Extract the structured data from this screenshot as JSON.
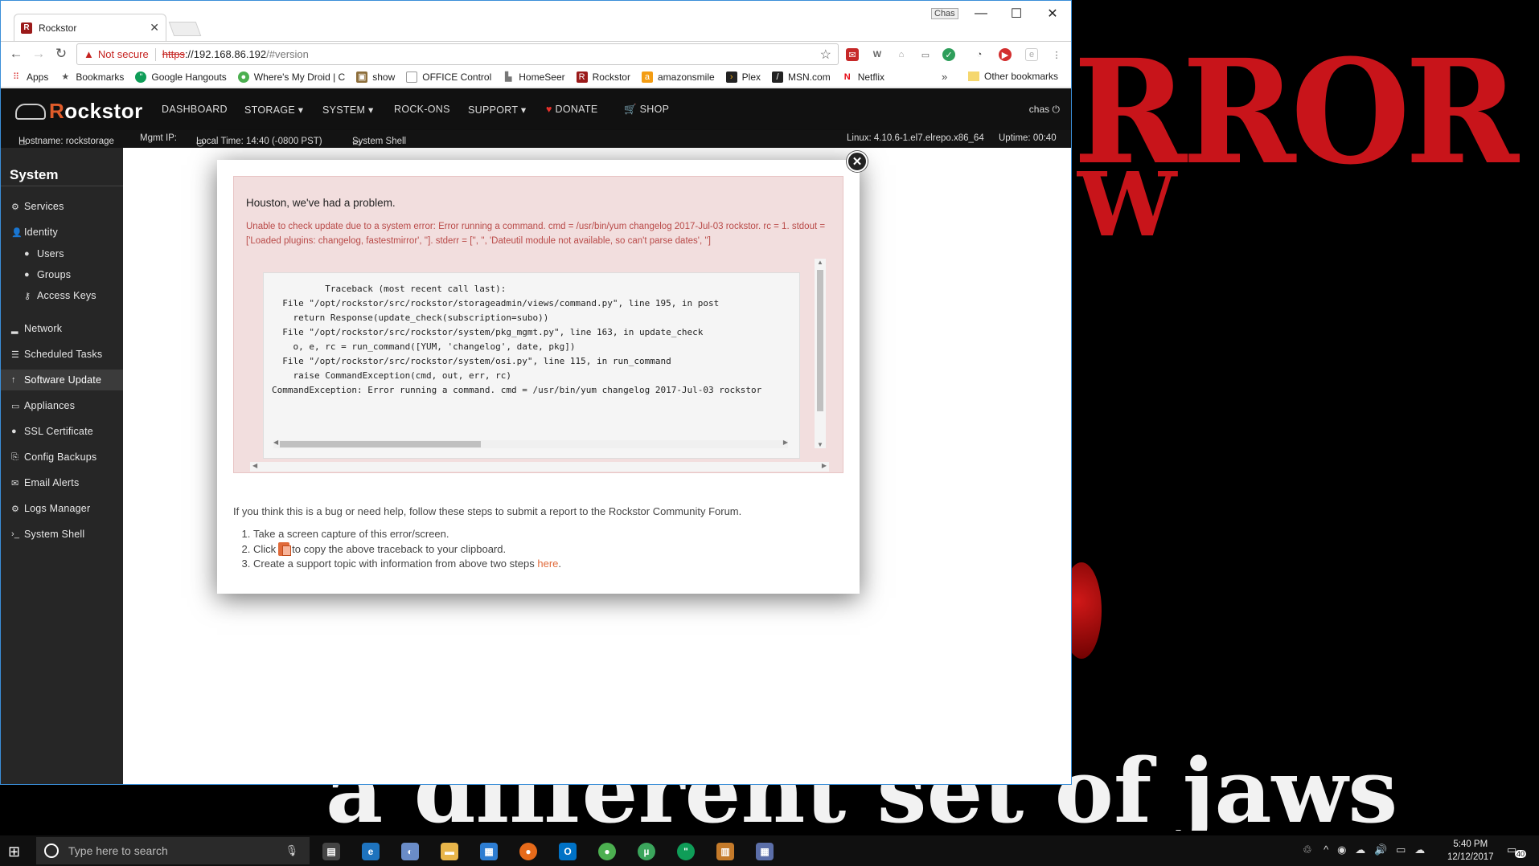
{
  "browser": {
    "tab_title": "Rockstor",
    "tab_favicon": "R",
    "window_user": "Chas",
    "address": {
      "security_label": "Not secure",
      "scheme": "https",
      "host": "://192.168.86.192",
      "path": "/#version"
    },
    "bookmarks": [
      {
        "label": "Apps",
        "icon": "apps-grid-icon"
      },
      {
        "label": "Bookmarks",
        "icon": "star-icon"
      },
      {
        "label": "Google Hangouts",
        "icon": "hangouts-icon"
      },
      {
        "label": "Where's My Droid | C",
        "icon": "droid-icon"
      },
      {
        "label": "show",
        "icon": "show-icon"
      },
      {
        "label": "OFFICE Control",
        "icon": "page-icon"
      },
      {
        "label": "HomeSeer",
        "icon": "homeseer-icon"
      },
      {
        "label": "Rockstor",
        "icon": "rockstor-icon"
      },
      {
        "label": "amazonsmile",
        "icon": "amazon-icon"
      },
      {
        "label": "Plex",
        "icon": "plex-icon"
      },
      {
        "label": "MSN.com",
        "icon": "msn-icon"
      },
      {
        "label": "Netflix",
        "icon": "netflix-icon"
      }
    ],
    "bookmarks_more": "»",
    "other_bookmarks": "Other bookmarks"
  },
  "app": {
    "brand_prefix": "R",
    "brand_rest": "ockstor",
    "nav": [
      {
        "label": "DASHBOARD"
      },
      {
        "label": "STORAGE ▾"
      },
      {
        "label": "SYSTEM ▾"
      },
      {
        "label": "ROCK-ONS"
      },
      {
        "label": "SUPPORT ▾"
      },
      {
        "label": "DONATE"
      },
      {
        "label": "SHOP"
      }
    ],
    "user": "chas",
    "infobar": {
      "hostname": "Hostname: rockstorage",
      "mgmt_ip": "Mgmt IP:",
      "local_time": "Local Time: 14:40 (-0800 PST)",
      "system_shell": "System Shell",
      "kernel": "Linux: 4.10.6-1.el7.elrepo.x86_64",
      "uptime": "Uptime: 00:40"
    },
    "sidebar": {
      "title": "System",
      "items": [
        {
          "label": "Services",
          "icon": "gear-icon"
        },
        {
          "label": "Identity",
          "icon": "user-icon"
        },
        {
          "label": "Users",
          "icon": "user-icon"
        },
        {
          "label": "Groups",
          "icon": "users-icon"
        },
        {
          "label": "Access Keys",
          "icon": "key-icon"
        },
        {
          "label": "Network",
          "icon": "signal-icon"
        },
        {
          "label": "Scheduled Tasks",
          "icon": "list-icon"
        },
        {
          "label": "Software Update",
          "icon": "arrow-up-icon"
        },
        {
          "label": "Appliances",
          "icon": "monitor-icon"
        },
        {
          "label": "SSL Certificate",
          "icon": "certificate-icon"
        },
        {
          "label": "Config Backups",
          "icon": "backup-icon"
        },
        {
          "label": "Email Alerts",
          "icon": "envelope-icon"
        },
        {
          "label": "Logs Manager",
          "icon": "gears-icon"
        },
        {
          "label": "System Shell",
          "icon": "terminal-icon"
        }
      ]
    }
  },
  "modal": {
    "title": "Houston, we've had a problem.",
    "message": "Unable to check update due to a system error: Error running a command. cmd = /usr/bin/yum changelog 2017-Jul-03 rockstor. rc = 1. stdout = ['Loaded plugins: changelog, fastestmirror', '']. stderr = ['', '', 'Dateutil module not available, so can't parse dates', '']",
    "traceback": "          Traceback (most recent call last):\n  File \"/opt/rockstor/src/rockstor/storageadmin/views/command.py\", line 195, in post\n    return Response(update_check(subscription=subo))\n  File \"/opt/rockstor/src/rockstor/system/pkg_mgmt.py\", line 163, in update_check\n    o, e, rc = run_command([YUM, 'changelog', date, pkg])\n  File \"/opt/rockstor/src/rockstor/system/osi.py\", line 115, in run_command\n    raise CommandException(cmd, out, err, rc)\nCommandException: Error running a command. cmd = /usr/bin/yum changelog 2017-Jul-03 rockstor",
    "help_intro": "If you think this is a bug or need help, follow these steps to submit a report to the Rockstor Community Forum.",
    "step1": "Take a screen capture of this error/screen.",
    "step2_before": "Click",
    "step2_after": "to copy the above traceback to your clipboard.",
    "step3_before": "Create a support topic with information from above two steps",
    "step3_link": "here",
    "step3_after": "."
  },
  "taskbar": {
    "search_placeholder": "Type here to search",
    "time": "5:40 PM",
    "date": "12/12/2017",
    "notification_count": "40"
  },
  "colors": {
    "brand_accent": "#e05c2a",
    "alert_bg": "#f2dede",
    "alert_text": "#b94a48",
    "donate_heart": "#e8312b"
  }
}
